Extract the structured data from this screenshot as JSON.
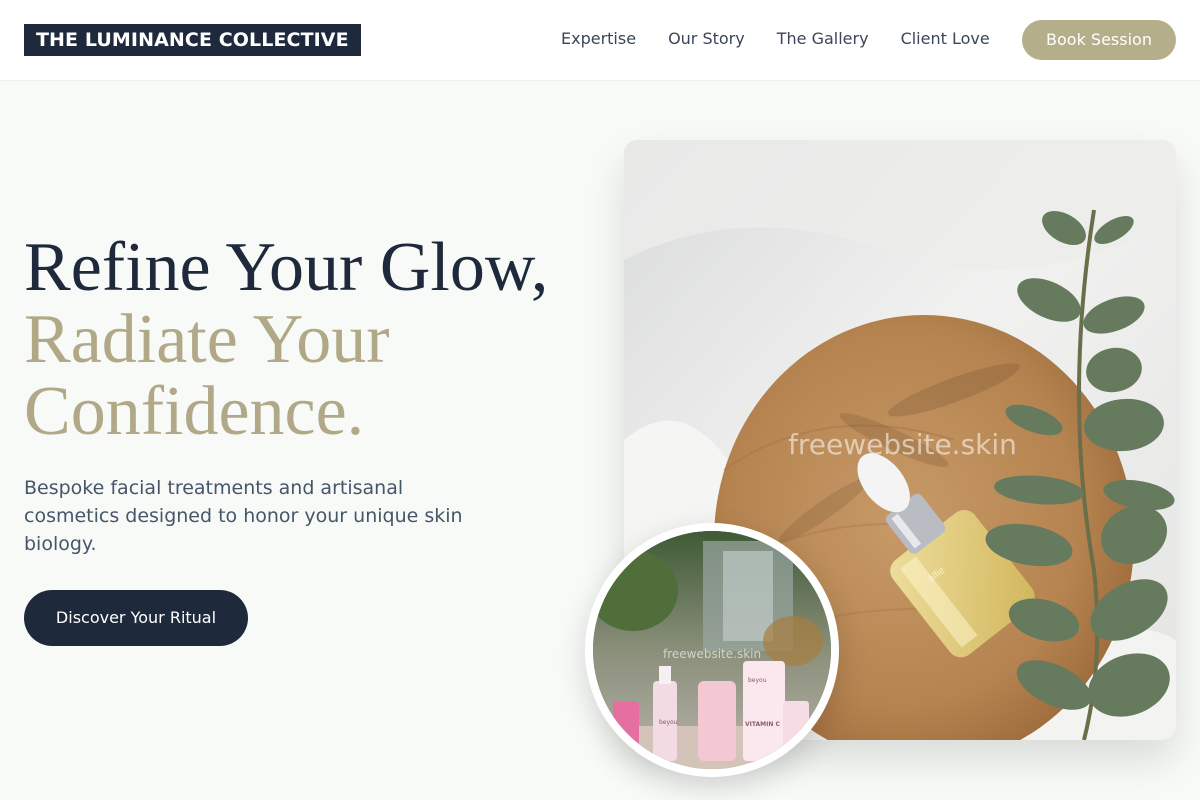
{
  "brand": {
    "name": "THE LUMINANCE COLLECTIVE"
  },
  "nav": {
    "items": [
      {
        "label": "Expertise"
      },
      {
        "label": "Our Story"
      },
      {
        "label": "The Gallery"
      },
      {
        "label": "Client Love"
      }
    ],
    "cta_label": "Book Session"
  },
  "hero": {
    "headline_line1": "Refine Your Glow,",
    "headline_line2": "Radiate Your Confidence.",
    "subtext": "Bespoke facial treatments and artisanal cosmetics designed to honor your unique skin biology.",
    "cta_label": "Discover Your Ritual"
  },
  "images": {
    "main_watermark": "freewebsite.skin",
    "circle_watermark": "freewebsite.skin",
    "bottle_label": "ёlfie",
    "product_brand": "beyou",
    "product_text": "VITAMIN C"
  },
  "colors": {
    "navy": "#1e293b",
    "accent": "#b5ae8a",
    "background": "#f8faf8"
  }
}
